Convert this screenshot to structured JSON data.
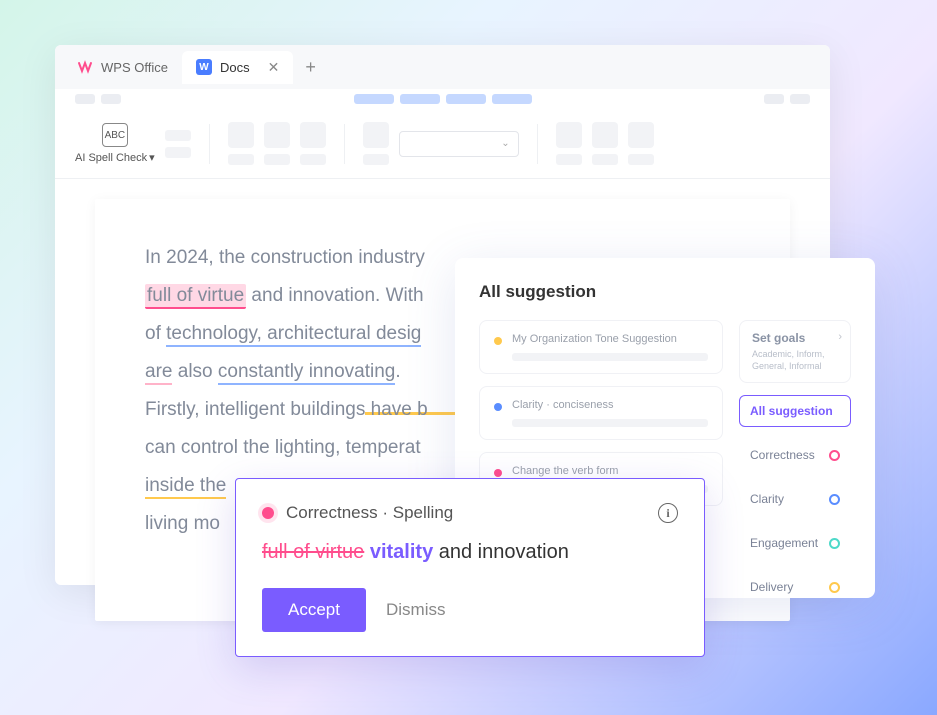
{
  "tabs": {
    "wps": "WPS Office",
    "docs": "Docs",
    "docs_icon_letter": "W"
  },
  "ribbon": {
    "ai_spell_icon_text": "ABC",
    "ai_spell_label": "AI Spell Check"
  },
  "document": {
    "line1_pre": "In 2024, the construction industry",
    "virtue": "full of virtue",
    "line1_post": " and innovation. With",
    "line2_pre": "of ",
    "tech": "technology, architectural desig",
    "are": "are",
    "line3_mid": " also ",
    "constantly": "constantly innovating",
    "period": ".",
    "line4": "Firstly, intelligent buildings have b",
    "line5": "can control the lighting, temperat",
    "inside": "inside the",
    "line7": "living mo"
  },
  "panel": {
    "title": "All suggestion",
    "items": [
      {
        "label": "My  Organization Tone Suggestion",
        "dot": "yellow"
      },
      {
        "label": "Clarity · conciseness",
        "dot": "blue"
      },
      {
        "label": "Change the verb form",
        "dot": "pink"
      }
    ],
    "goals_title": "Set goals",
    "goals_sub": "Academic, Inform, General, Informal",
    "filters": {
      "all": "All suggestion",
      "correctness": "Correctness",
      "clarity": "Clarity",
      "engagement": "Engagement",
      "delivery": "Delivery"
    }
  },
  "card": {
    "category": "Correctness · Spelling",
    "strike": "full of virtue",
    "replace": "vitality",
    "rest": " and innovation",
    "accept": "Accept",
    "dismiss": "Dismiss"
  }
}
